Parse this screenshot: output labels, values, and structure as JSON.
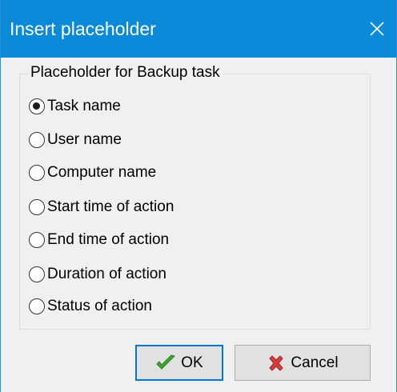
{
  "window": {
    "title": "Insert placeholder",
    "close_icon": "close-icon"
  },
  "group": {
    "legend": "Placeholder for Backup task",
    "selected_index": 0,
    "options": [
      "Task name",
      "User name",
      "Computer name",
      "Start time of action",
      "End time of action",
      "Duration of action",
      "Status of action"
    ]
  },
  "buttons": {
    "ok_label": "OK",
    "ok_icon": "checkmark-icon",
    "cancel_label": "Cancel",
    "cancel_icon": "cross-icon"
  },
  "colors": {
    "titlebar": "#0a8ad8",
    "dialog_bg": "#f0f0f0",
    "focus_border": "#0078d7",
    "ok_icon": "#3aa832",
    "cancel_icon": "#d93a3a"
  }
}
